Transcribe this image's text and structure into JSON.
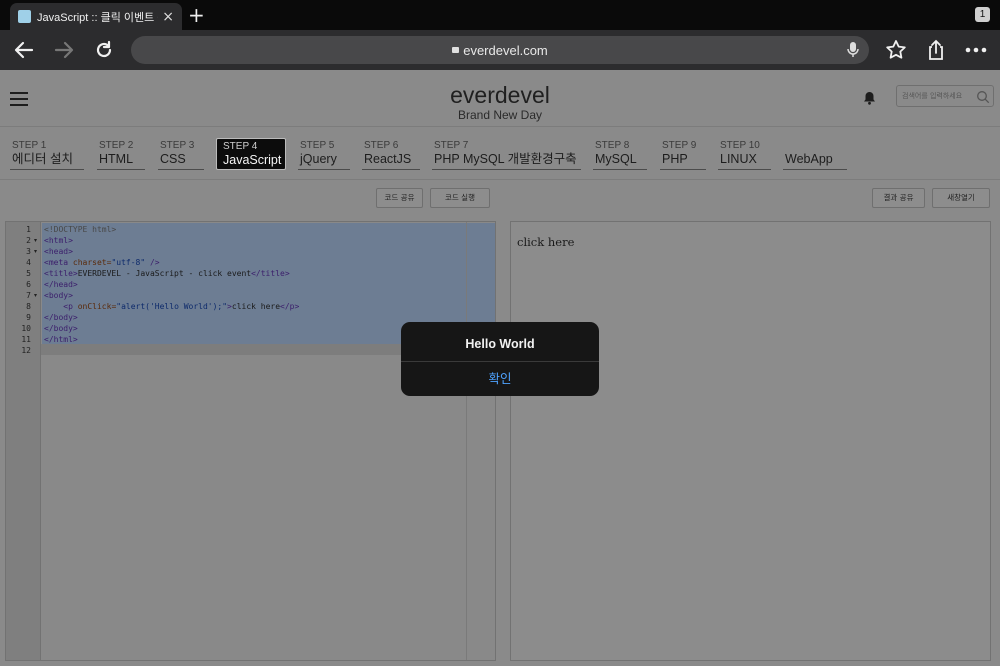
{
  "browser": {
    "tab_title": "JavaScript :: 클릭 이벤트 생",
    "tab_count": "1",
    "url": "everdevel.com",
    "new_tab": "+",
    "close": "×"
  },
  "site": {
    "logo": "everdevel",
    "slogan": "Brand New Day",
    "search_placeholder": "검색어를 입력하세요"
  },
  "steps": [
    {
      "num": "STEP 1",
      "name": "에디터 설치"
    },
    {
      "num": "STEP 2",
      "name": "HTML"
    },
    {
      "num": "STEP 3",
      "name": "CSS"
    },
    {
      "num": "STEP 4",
      "name": "JavaScript",
      "active": true
    },
    {
      "num": "STEP 5",
      "name": "jQuery"
    },
    {
      "num": "STEP 6",
      "name": "ReactJS"
    },
    {
      "num": "STEP 7",
      "name": "PHP MySQL 개발환경구축"
    },
    {
      "num": "STEP 8",
      "name": "MySQL"
    },
    {
      "num": "STEP 9",
      "name": "PHP"
    },
    {
      "num": "STEP 10",
      "name": "LINUX"
    },
    {
      "num": "",
      "name": "WebApp"
    }
  ],
  "buttons": {
    "code_share": "코드 공유",
    "code_run": "코드 실행",
    "result_share": "결과 공유",
    "new_window": "새창열기"
  },
  "editor": {
    "line_numbers": [
      "1",
      "2",
      "3",
      "4",
      "5",
      "6",
      "7",
      "8",
      "9",
      "10",
      "11",
      "12"
    ],
    "code": {
      "l1": "<!DOCTYPE html>",
      "l2": "<html>",
      "l3": "<head>",
      "l4_tag": "<meta",
      "l4_attr": " charset=",
      "l4_val": "\"utf-8\"",
      "l4_end": " />",
      "l5_open": "<title>",
      "l5_text": "EVERDEVEL - JavaScript - click event",
      "l5_close": "</title>",
      "l6": "</head>",
      "l7": "<body>",
      "l8_indent": "    ",
      "l8_tag": "<p",
      "l8_attr": " onClick=",
      "l8_val": "\"alert('Hello World');\"",
      "l8_gt": ">",
      "l8_text": "click here",
      "l8_close": "</p>",
      "l9": "</body>",
      "l10": "</body>",
      "l11": "</html>"
    }
  },
  "preview": {
    "text": "click here"
  },
  "alert": {
    "message": "Hello World",
    "confirm": "확인"
  }
}
